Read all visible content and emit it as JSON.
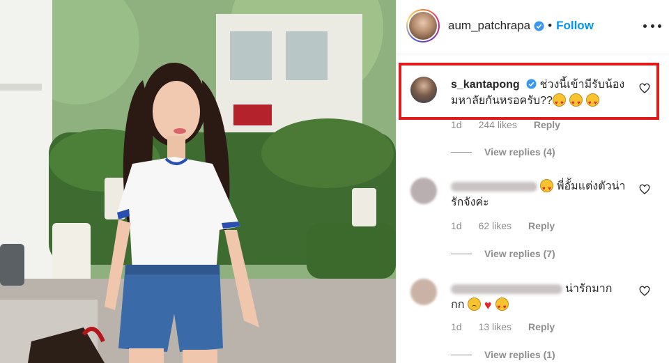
{
  "header": {
    "username": "aum_patchrapa",
    "separator": "•",
    "follow_label": "Follow"
  },
  "comments": [
    {
      "username": "s_kantapong",
      "verified": true,
      "text_line1": "ช่วงนี้เข้ามีรับน้อง",
      "text_line2": "มหาลัยกันหรอครับ??",
      "emoji": [
        "heart-eyes",
        "heart-eyes",
        "heart-eyes"
      ],
      "age": "1d",
      "likes": "244 likes",
      "reply_label": "Reply",
      "view_replies": "View replies (4)"
    },
    {
      "username_blurred": true,
      "text_line1": "พี่อั้มแต่งตัวน่า",
      "text_line2": "รักจังค่ะ",
      "emoji": [
        "heart-eyes"
      ],
      "age": "1d",
      "likes": "62 likes",
      "reply_label": "Reply",
      "view_replies": "View replies (7)"
    },
    {
      "username_blurred": true,
      "text_line1": "น่ารักมาก",
      "text_line2": "กก",
      "emoji": [
        "frown",
        "heart-red",
        "heart-eyes"
      ],
      "age": "1d",
      "likes": "13 likes",
      "reply_label": "Reply",
      "view_replies": "View replies (1)"
    }
  ],
  "colors": {
    "follow_blue": "#0095f6",
    "verified_blue": "#3897f0",
    "highlight_red": "#e01b1b",
    "muted_gray": "#8e8e8e"
  },
  "icons": [
    "verified-badge-icon",
    "more-options-icon",
    "heart-outline-icon"
  ]
}
